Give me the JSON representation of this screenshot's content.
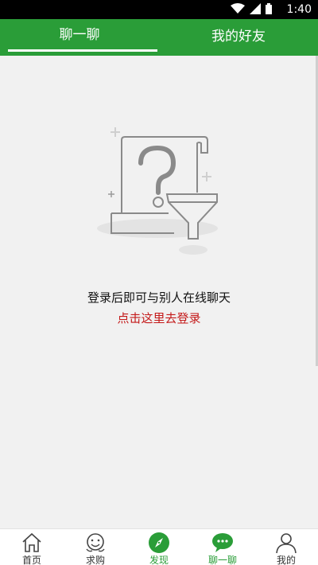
{
  "status_bar": {
    "time": "1:40",
    "wifi_icon": "wifi-icon",
    "signal_icon": "signal-icon",
    "battery_icon": "battery-icon"
  },
  "tabs": [
    {
      "label": "聊一聊",
      "active": true
    },
    {
      "label": "我的好友",
      "active": false
    }
  ],
  "empty_state": {
    "illustration_icon": "question-document-funnel-icon",
    "message": "登录后即可与别人在线聊天",
    "login_link": "点击这里去登录"
  },
  "colors": {
    "brand": "#2a9d38",
    "link": "#c41919",
    "background": "#f1f1f1"
  },
  "bottom_nav": [
    {
      "label": "首页",
      "icon": "home-icon"
    },
    {
      "label": "求购",
      "icon": "face-icon"
    },
    {
      "label": "发现",
      "icon": "compass-icon"
    },
    {
      "label": "聊一聊",
      "icon": "chat-icon",
      "active": true
    },
    {
      "label": "我的",
      "icon": "person-icon"
    }
  ]
}
